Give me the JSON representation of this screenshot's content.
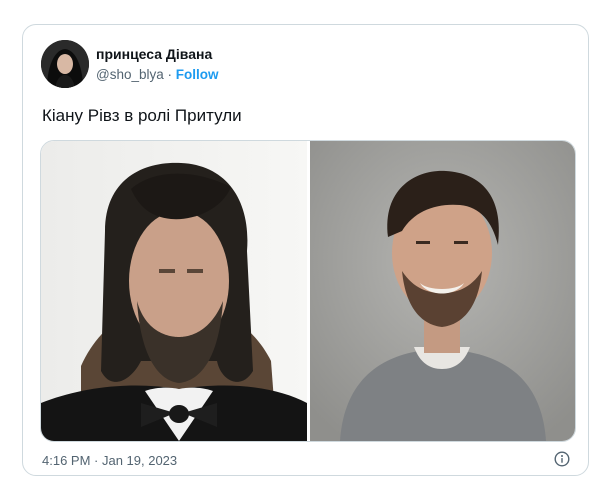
{
  "tweet": {
    "author": {
      "display_name": "принцеса Дівана",
      "handle": "@sho_blya",
      "separator": " · ",
      "follow_label": "Follow"
    },
    "text": "Кіану Рівз в ролі Притули",
    "timestamp": "4:16 PM · Jan 19, 2023"
  },
  "colors": {
    "accent": "#1d9bf0",
    "text": "#0f1419",
    "muted": "#536471",
    "border": "#cfd9de"
  },
  "icons": {
    "info": "info-circle-icon"
  }
}
